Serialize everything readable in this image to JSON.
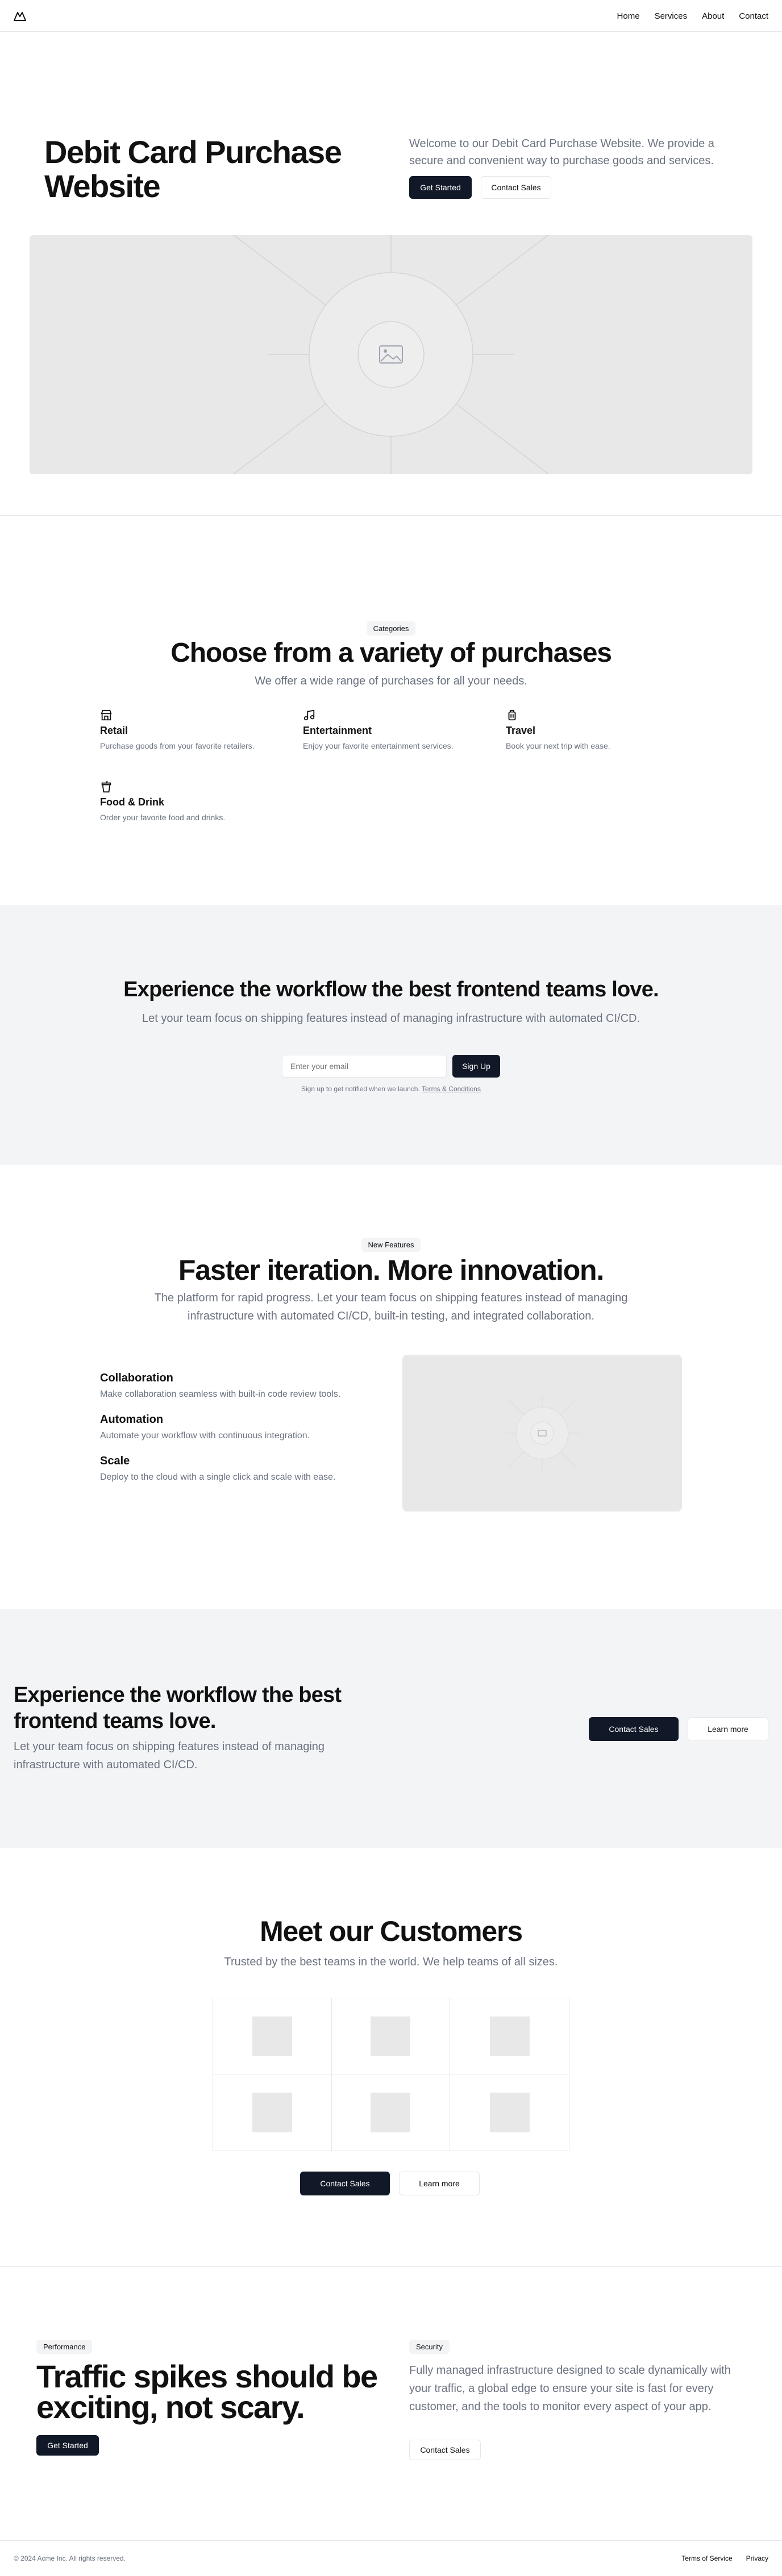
{
  "header": {
    "logo_icon": "acme-mountain-icon",
    "nav": [
      {
        "label": "Home"
      },
      {
        "label": "Services"
      },
      {
        "label": "About"
      },
      {
        "label": "Contact"
      }
    ]
  },
  "hero": {
    "title": "Debit Card Purchase Website",
    "description": "Welcome to our Debit Card Purchase Website. We provide a secure and convenient way to purchase goods and services.",
    "primary_label": "Get Started",
    "secondary_label": "Contact Sales",
    "image_icon": "image-placeholder-icon"
  },
  "categories": {
    "badge": "Categories",
    "title": "Choose from a variety of purchases",
    "subtitle": "We offer a wide range of purchases for all your needs.",
    "items": [
      {
        "icon": "store-icon",
        "title": "Retail",
        "description": "Purchase goods from your favorite retailers."
      },
      {
        "icon": "music-icon",
        "title": "Entertainment",
        "description": "Enjoy your favorite entertainment services."
      },
      {
        "icon": "luggage-icon",
        "title": "Travel",
        "description": "Book your next trip with ease."
      },
      {
        "icon": "cup-icon",
        "title": "Food & Drink",
        "description": "Order your favorite food and drinks."
      }
    ]
  },
  "cta_signup": {
    "title": "Experience the workflow the best frontend teams love.",
    "description": "Let your team focus on shipping features instead of managing infrastructure with automated CI/CD.",
    "input_placeholder": "Enter your email",
    "button_label": "Sign Up",
    "note": "Sign up to get notified when we launch.",
    "note_link": "Terms & Conditions"
  },
  "features": {
    "badge": "New Features",
    "title": "Faster iteration. More innovation.",
    "description": "The platform for rapid progress. Let your team focus on shipping features instead of managing infrastructure with automated CI/CD, built-in testing, and integrated collaboration.",
    "items": [
      {
        "title": "Collaboration",
        "description": "Make collaboration seamless with built-in code review tools."
      },
      {
        "title": "Automation",
        "description": "Automate your workflow with continuous integration."
      },
      {
        "title": "Scale",
        "description": "Deploy to the cloud with a single click and scale with ease."
      }
    ]
  },
  "cta_contact": {
    "title": "Experience the workflow the best frontend teams love.",
    "description": "Let your team focus on shipping features instead of managing infrastructure with automated CI/CD.",
    "primary_label": "Contact Sales",
    "secondary_label": "Learn more"
  },
  "customers": {
    "title": "Meet our Customers",
    "subtitle": "Trusted by the best teams in the world. We help teams of all sizes.",
    "primary_label": "Contact Sales",
    "secondary_label": "Learn more"
  },
  "traffic": {
    "badge_left": "Performance",
    "title": "Traffic spikes should be exciting, not scary.",
    "button_label": "Get Started",
    "badge_right": "Security",
    "description": "Fully managed infrastructure designed to scale dynamically with your traffic, a global edge to ensure your site is fast for every customer, and the tools to monitor every aspect of your app.",
    "secondary_label": "Contact Sales"
  },
  "footer": {
    "copyright": "© 2024 Acme Inc. All rights reserved.",
    "links": [
      {
        "label": "Terms of Service"
      },
      {
        "label": "Privacy"
      }
    ]
  }
}
